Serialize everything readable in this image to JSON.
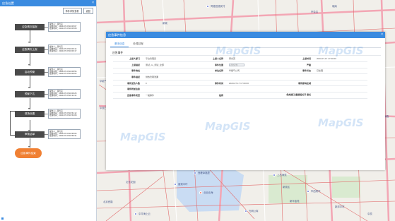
{
  "left_panel": {
    "title": "应急处置",
    "close_glyph": "×",
    "buttons": [
      "事件详情查看",
      "返回"
    ],
    "steps": [
      {
        "label": "应急情况接报",
        "info": [
          "操作人：黄光英",
          "接收时间：2023-07-05 16:05:07",
          "处理时间：2023-07-05 16:05:08"
        ]
      },
      {
        "label": "应急情况上报",
        "info": [
          "操作人：黄光英",
          "接收时间：2023-07-05 16:06:14",
          "处理时间：2023-07-05 16:06:17"
        ]
      },
      {
        "label": "启动预案",
        "info": [
          "操作人：黄光英",
          "接收时间：2023-07-05 16:08:56",
          "处理时间：2023-07-05 16:09:02"
        ]
      },
      {
        "label": "预案下达",
        "info": [
          "操作人：黄光英",
          "接收时间：2023-07-05 16:09:25",
          "处理时间：2023-07-05 16:11:10"
        ]
      },
      {
        "label": "现场处置",
        "info": [
          "操作人：黄光英",
          "接收时间：2023-07-05 16:51:12",
          "处理时间：2023-07-05 16:54:08"
        ]
      },
      {
        "label": "审核结单",
        "info": [
          "操作人：黄光英",
          "接收时间：2023-07-05 16:55:06",
          "处理时间：2023-07-05 16:56:31"
        ]
      }
    ],
    "final_step": "应急事件结束"
  },
  "dialog": {
    "title": "应急事件信息",
    "close_glyph": "×",
    "tabs": [
      "基本信息",
      "处理过程"
    ],
    "section_title": "应急事件",
    "rows": [
      [
        {
          "l": "上报人部门",
          "v": "平台管理员"
        },
        {
          "l": "上报人名称",
          "v": "黄光英"
        },
        {
          "l": "上报时间",
          "v": "2023-07-17 17:00:00"
        }
      ],
      [
        {
          "l": "上报描述",
          "v": "测试_cs_测试_全部"
        },
        {
          "l": "事件位置",
          "v": "",
          "input": "点击定位"
        },
        {
          "l": "严重",
          "v": ""
        }
      ],
      [
        {
          "l": "事件地址",
          "v": ""
        },
        {
          "l": "单位名称",
          "v": "华能气公司"
        },
        {
          "l": "事件状态",
          "v": "已处理"
        }
      ],
      [
        {
          "l": "事件描述",
          "v": "供热管网泄漏"
        },
        {
          "l": "",
          "v": ""
        },
        {
          "l": "",
          "v": ""
        }
      ],
      [
        {
          "l": "事件受伤人数",
          "v": "0"
        },
        {
          "l": "事件时间",
          "v": "2023-07-17 17:00:00"
        },
        {
          "l": "事件影响区域",
          "v": ""
        }
      ],
      [
        {
          "l": "事件附加信息",
          "v": ""
        },
        {
          "l": "",
          "v": ""
        },
        {
          "l": "",
          "v": ""
        }
      ],
      [
        {
          "l": "应急事件类型",
          "v": "一般事件"
        },
        {
          "l": "指挥",
          "v": ""
        },
        {
          "l": "供热接口/直接相关开\n接关",
          "v": ""
        }
      ]
    ]
  },
  "map": {
    "labels": [
      "同德田德安村",
      "宗会吉",
      "华能气公园",
      "中国三江文化",
      "西峰幸福里",
      "上岛海苑",
      "文化花园",
      "香港中环",
      "北京北海",
      "新奥区",
      "华西财华",
      "北京西路",
      "新华金苑",
      "新邦中村",
      "中华海上云",
      "光明公寓",
      "上海路",
      "城南",
      "新城",
      "中辰"
    ]
  },
  "watermark": "MapGIS",
  "colors": {
    "accent": "#3a8be0",
    "final": "#f08033",
    "step": "#4a4a4a"
  }
}
